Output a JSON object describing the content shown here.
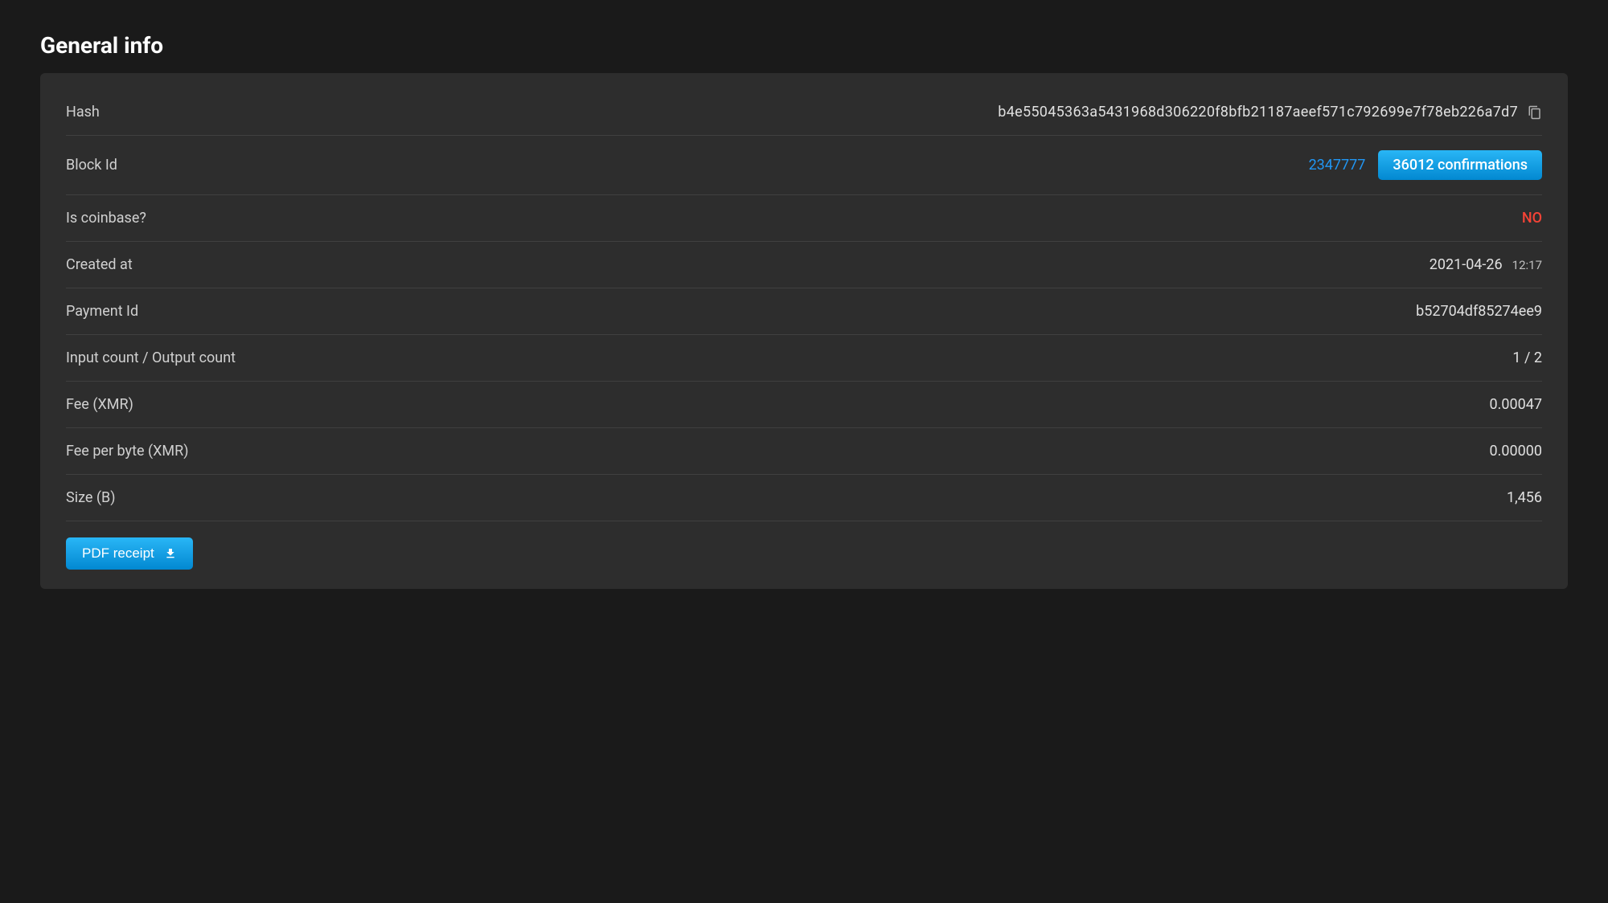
{
  "section": {
    "title": "General info"
  },
  "rows": {
    "hash": {
      "label": "Hash",
      "value": "b4e55045363a5431968d306220f8bfb21187aeef571c792699e7f78eb226a7d7"
    },
    "blockId": {
      "label": "Block Id",
      "value": "2347777",
      "confirmations": "36012 confirmations"
    },
    "coinbase": {
      "label": "Is coinbase?",
      "value": "NO"
    },
    "createdAt": {
      "label": "Created at",
      "date": "2021-04-26",
      "time": "12:17"
    },
    "paymentId": {
      "label": "Payment Id",
      "value": "b52704df85274ee9"
    },
    "ioCount": {
      "label": "Input count / Output count",
      "value": "1 / 2"
    },
    "fee": {
      "label": "Fee (XMR)",
      "value": "0.00047"
    },
    "feePerByte": {
      "label": "Fee per byte (XMR)",
      "value": "0.00000"
    },
    "size": {
      "label": "Size (B)",
      "value": "1,456"
    }
  },
  "actions": {
    "pdfReceipt": "PDF receipt"
  }
}
